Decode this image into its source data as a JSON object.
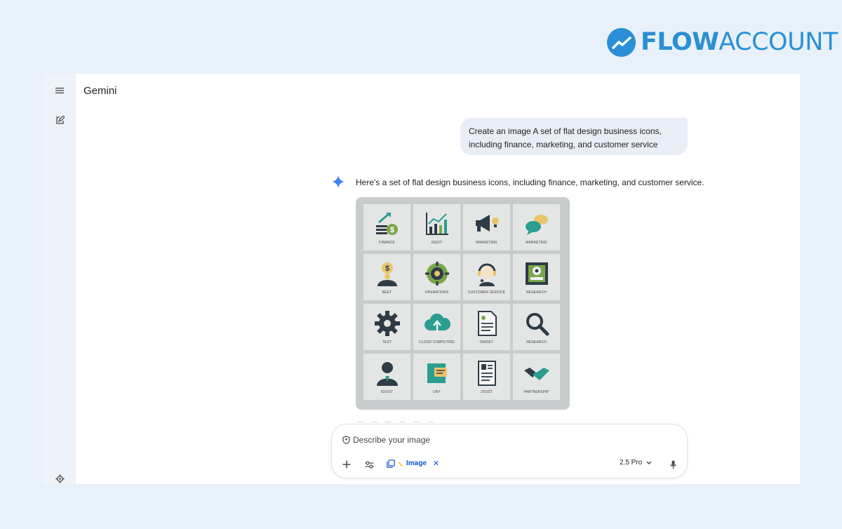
{
  "brand": {
    "name_bold": "FLOW",
    "name_light": "ACCOUNT",
    "color": "#2a8fd6"
  },
  "app": {
    "title": "Gemini"
  },
  "rail": {
    "menu_icon": "hamburger-menu-icon",
    "new_chat_icon": "edit-icon",
    "settings_icon": "gear-icon"
  },
  "chat": {
    "user_prompt": "Create an image A set of flat design business icons, including finance, marketing, and customer service",
    "response_text": "Here's a set of flat design business icons, including finance, marketing, and customer service.",
    "image_tiles": [
      {
        "label": "FINANCE",
        "icon": "finance-icon"
      },
      {
        "label": "IGEXT",
        "icon": "growth-chart-icon"
      },
      {
        "label": "MARKETING",
        "icon": "megaphone-icon"
      },
      {
        "label": "MARKETING",
        "icon": "chat-bubbles-icon"
      },
      {
        "label": "BEET",
        "icon": "businessman-dollar-icon"
      },
      {
        "label": "OPERATIONS",
        "icon": "operations-target-icon"
      },
      {
        "label": "CUSTOMER SERVICE",
        "icon": "headset-agent-icon"
      },
      {
        "label": "RESEARCH",
        "icon": "research-board-icon"
      },
      {
        "label": "TEST",
        "icon": "gear-icon"
      },
      {
        "label": "CLOUD COMPUTING",
        "icon": "cloud-upload-icon"
      },
      {
        "label": "INADET",
        "icon": "document-icon"
      },
      {
        "label": "RESEARCH",
        "icon": "magnifier-icon"
      },
      {
        "label": "IGIUST",
        "icon": "person-icon"
      },
      {
        "label": "UNY",
        "icon": "notes-icon"
      },
      {
        "label": "JOUST",
        "icon": "resume-icon"
      },
      {
        "label": "PARTNERSHIP",
        "icon": "handshake-icon"
      }
    ]
  },
  "composer": {
    "placeholder": "Describe your image",
    "tool_chip": "Image",
    "model": "2.5 Pro"
  }
}
